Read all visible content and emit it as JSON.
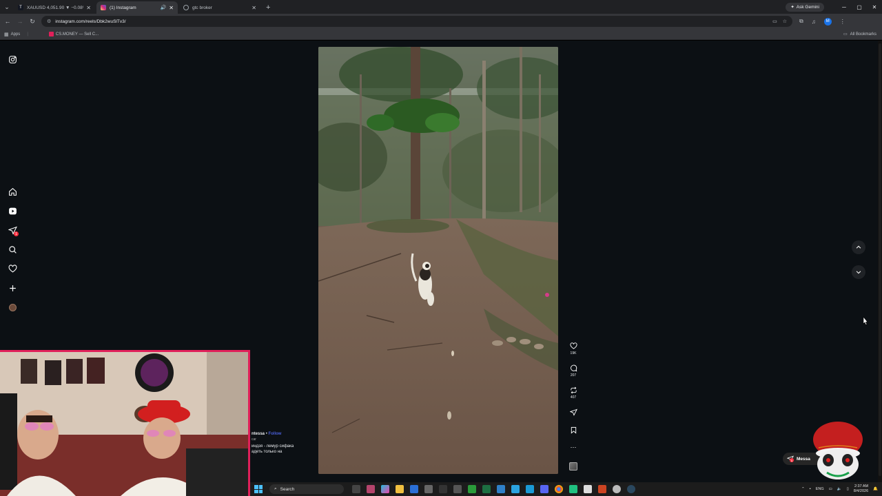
{
  "browser": {
    "tabs": [
      {
        "title": "XAUUSD 4,051.90 ▼ −0.08% C",
        "active": false,
        "favicon_color": "#2962ff",
        "favicon": "TV"
      },
      {
        "title": "(1) Instagram",
        "active": true,
        "favicon_color": "#d62976",
        "favicon": "ig",
        "audio": true
      },
      {
        "title": "gtc broker",
        "active": false,
        "favicon_color": "#5f6368",
        "favicon": "G"
      }
    ],
    "new_tab": "+",
    "ask_gemini": "Ask Gemini",
    "url": "instagram.com/reels/Dbk2wuSlTv3/",
    "profile_initial": "M",
    "bookmarks": [
      {
        "label": "Apps"
      },
      {
        "label": "CS.MONEY — Sell C..."
      }
    ],
    "all_bookmarks": "All Bookmarks"
  },
  "instagram": {
    "sidebar_icons": [
      "instagram-logo-icon",
      "home-icon",
      "reels-icon",
      "messages-icon",
      "search-icon",
      "notifications-heart-icon",
      "create-plus-icon",
      "profile-avatar"
    ],
    "messages_badge": "1",
    "reel": {
      "likes": "19K",
      "comments": "207",
      "reposts": "407",
      "caption_user": "ntessa",
      "caption_follow": "Follow",
      "caption_sub": "car",
      "caption_line1": "индзя - лемур сифака",
      "caption_line2": "адеть только на"
    },
    "messages_button": {
      "label": "Messa",
      "badge": "1"
    }
  },
  "taskbar": {
    "search_placeholder": "Search",
    "lang": "ENG",
    "time": "2:37 AM",
    "date": "8/4/2026"
  },
  "colors": {
    "accent_red": "#ff3040",
    "follow_blue": "#4a5fd9",
    "webcam_border": "#e0205a"
  }
}
